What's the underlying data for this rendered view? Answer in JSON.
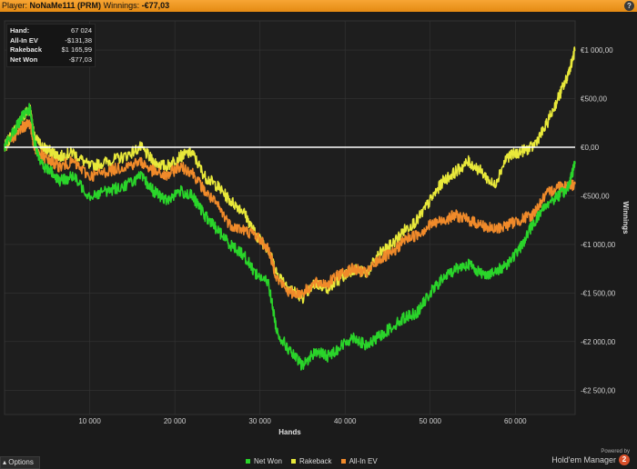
{
  "header": {
    "player_label": "Player:",
    "player_name": "NoNaMe111 (PRM)",
    "winnings_label": "Winnings:",
    "winnings_value": "-€77,03",
    "help": "?"
  },
  "info": {
    "rows": [
      {
        "label": "Hand:",
        "value": "67 024"
      },
      {
        "label": "All-In EV",
        "value": "-$131,38"
      },
      {
        "label": "Rakeback",
        "value": "$1 165,99"
      },
      {
        "label": "Net Won",
        "value": "-$77,03"
      }
    ]
  },
  "footer": {
    "options_label": "Options",
    "powered_by": "Powered by",
    "brand": "Hold'em Manager",
    "brand_badge": "2"
  },
  "chart_data": {
    "type": "line",
    "xlabel": "Hands",
    "ylabel": "Winnings",
    "xlim": [
      0,
      67024
    ],
    "ylim": [
      -2750,
      1300
    ],
    "x_ticks": [
      10000,
      20000,
      30000,
      40000,
      50000,
      60000
    ],
    "x_tick_labels": [
      "10 000",
      "20 000",
      "30 000",
      "40 000",
      "50 000",
      "60 000"
    ],
    "y_ticks": [
      1000,
      500,
      0,
      -500,
      -1000,
      -1500,
      -2000,
      -2500
    ],
    "y_tick_labels": [
      "€1 000,00",
      "€500,00",
      "€0,00",
      "-€500,00",
      "-€1 000,00",
      "-€1 500,00",
      "-€2 000,00",
      "-€2 500,00"
    ],
    "grid": true,
    "legend_position": "bottom",
    "series": [
      {
        "name": "Net Won",
        "color": "#2ad42a",
        "x": [
          0,
          1000,
          2000,
          3000,
          3500,
          4500,
          5500,
          6500,
          8000,
          10000,
          12000,
          14000,
          16000,
          17500,
          19000,
          20500,
          22000,
          23500,
          25000,
          26500,
          28000,
          29500,
          31000,
          32000,
          33500,
          35000,
          36500,
          38000,
          39500,
          41000,
          42500,
          44000,
          45500,
          47000,
          48500,
          50000,
          51500,
          53000,
          54500,
          56000,
          57500,
          59000,
          60500,
          62000,
          63500,
          65000,
          66000,
          67024
        ],
        "y": [
          0,
          150,
          300,
          400,
          50,
          -200,
          -250,
          -350,
          -300,
          -500,
          -450,
          -400,
          -300,
          -450,
          -550,
          -450,
          -500,
          -700,
          -850,
          -1000,
          -1100,
          -1300,
          -1400,
          -1900,
          -2100,
          -2250,
          -2100,
          -2150,
          -2050,
          -1950,
          -2050,
          -1950,
          -1850,
          -1750,
          -1700,
          -1500,
          -1350,
          -1250,
          -1200,
          -1300,
          -1300,
          -1200,
          -1050,
          -800,
          -600,
          -500,
          -450,
          -170
        ]
      },
      {
        "name": "Rakeback",
        "color": "#e8e83a",
        "x": [
          0,
          1000,
          2000,
          3000,
          3500,
          4500,
          5500,
          6500,
          8000,
          10000,
          12000,
          14000,
          16000,
          17500,
          19000,
          20500,
          22000,
          23500,
          25000,
          26500,
          28000,
          29500,
          31000,
          32000,
          33500,
          35000,
          36500,
          38000,
          39500,
          41000,
          42500,
          44000,
          45500,
          47000,
          48500,
          50000,
          51500,
          53000,
          54500,
          56000,
          57500,
          59000,
          60500,
          62000,
          63500,
          65000,
          66000,
          67024
        ],
        "y": [
          0,
          150,
          300,
          400,
          100,
          0,
          -50,
          -100,
          -50,
          -200,
          -150,
          -100,
          0,
          -150,
          -200,
          -100,
          -50,
          -300,
          -400,
          -550,
          -650,
          -900,
          -1050,
          -1300,
          -1450,
          -1550,
          -1400,
          -1450,
          -1350,
          -1250,
          -1300,
          -1100,
          -1000,
          -850,
          -750,
          -550,
          -350,
          -250,
          -150,
          -250,
          -400,
          -100,
          -50,
          0,
          200,
          500,
          700,
          1000
        ]
      },
      {
        "name": "All-In EV",
        "color": "#f08a2a",
        "x": [
          0,
          1000,
          2000,
          3000,
          3500,
          4500,
          5500,
          6500,
          8000,
          10000,
          12000,
          14000,
          16000,
          17500,
          19000,
          20500,
          22000,
          23500,
          25000,
          26500,
          28000,
          29500,
          31000,
          32000,
          33500,
          35000,
          36500,
          38000,
          39500,
          41000,
          42500,
          44000,
          45500,
          47000,
          48500,
          50000,
          51500,
          53000,
          54500,
          56000,
          57500,
          59000,
          60500,
          62000,
          63500,
          65000,
          66000,
          67024
        ],
        "y": [
          0,
          100,
          200,
          250,
          0,
          -100,
          -150,
          -200,
          -150,
          -300,
          -250,
          -200,
          -150,
          -250,
          -300,
          -200,
          -250,
          -450,
          -600,
          -800,
          -850,
          -900,
          -1050,
          -1350,
          -1500,
          -1500,
          -1400,
          -1400,
          -1300,
          -1250,
          -1300,
          -1150,
          -1100,
          -950,
          -900,
          -800,
          -750,
          -700,
          -750,
          -800,
          -850,
          -800,
          -750,
          -700,
          -500,
          -400,
          -400,
          -380
        ]
      }
    ]
  }
}
